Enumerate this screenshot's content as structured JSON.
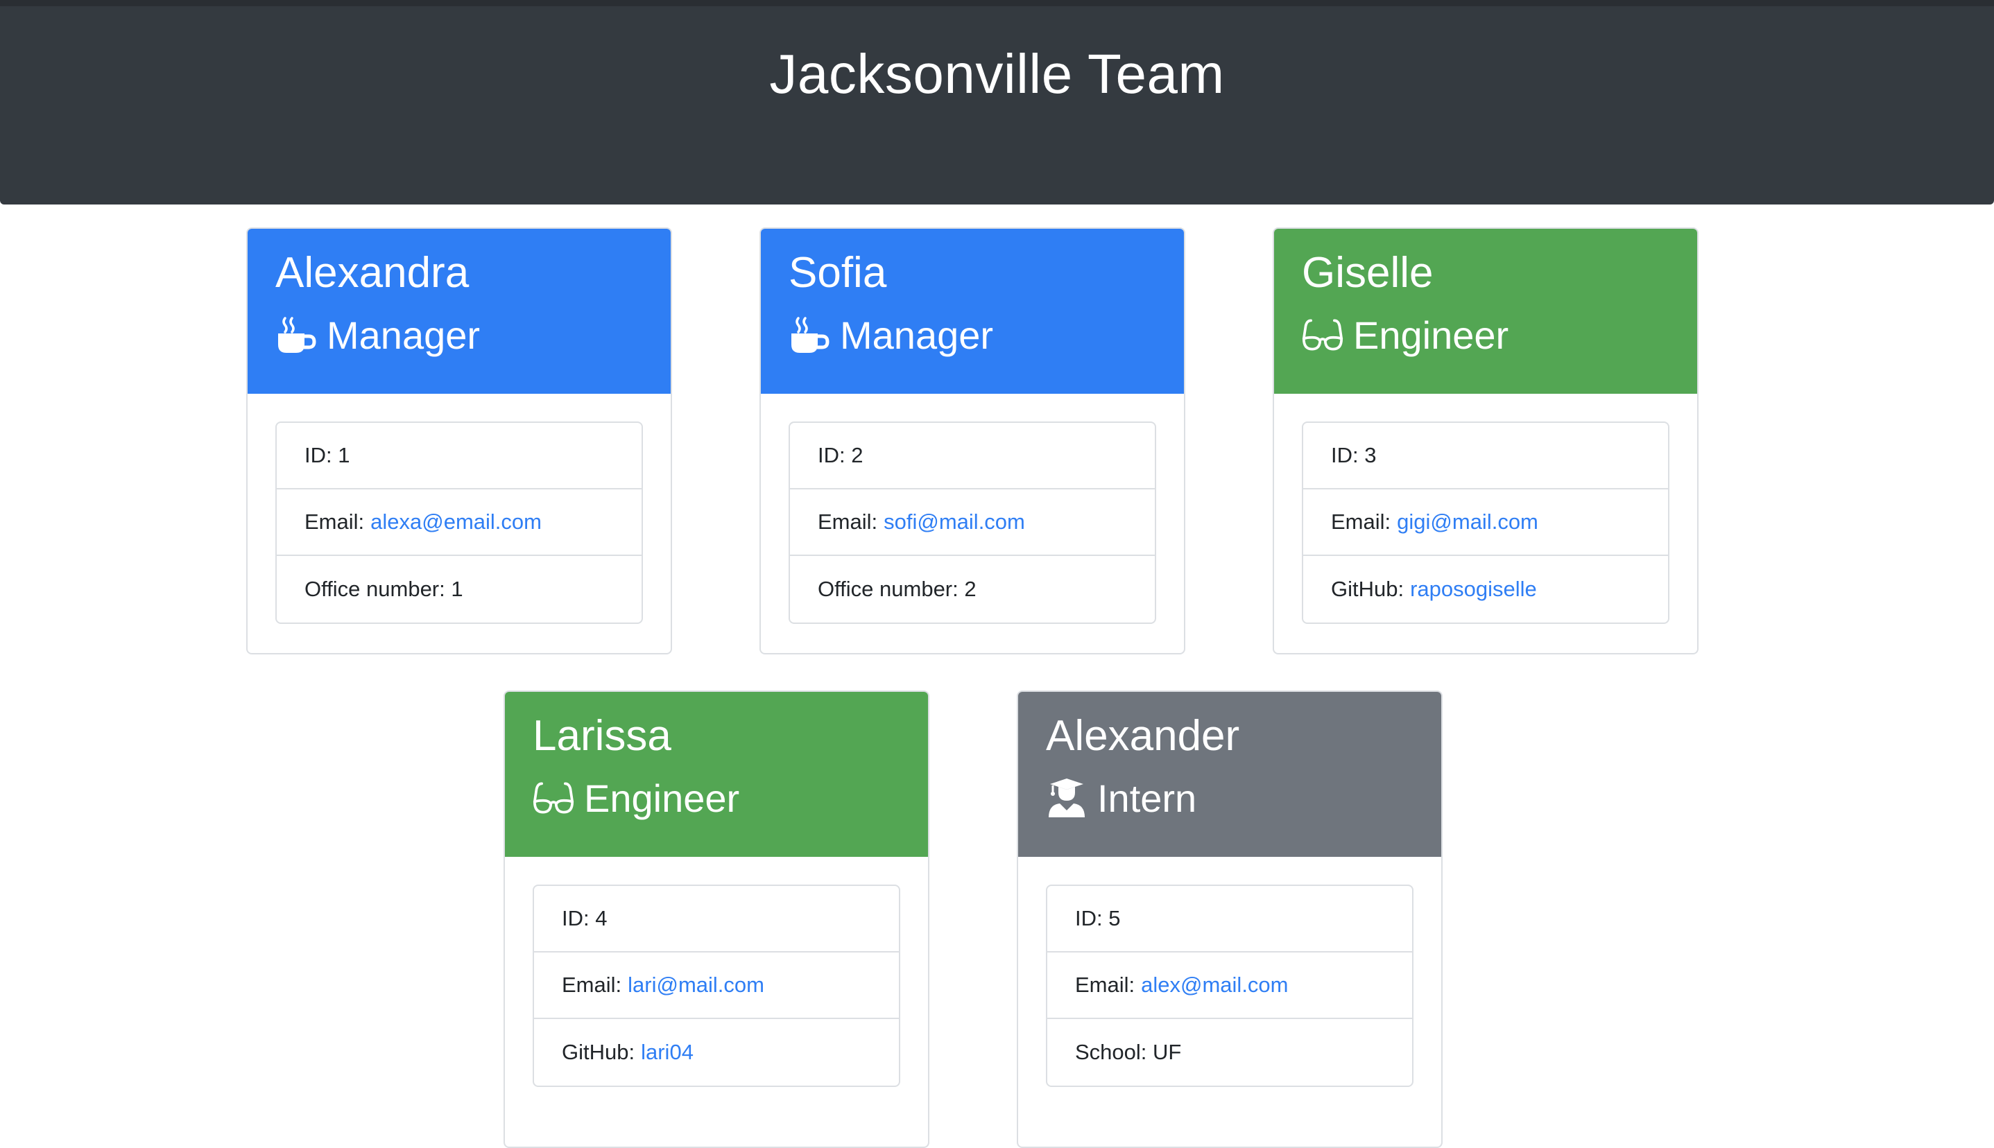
{
  "header": {
    "title": "Jacksonville Team"
  },
  "colors": {
    "manager": "#2f7ef4",
    "engineer": "#53a653",
    "intern": "#6f757d",
    "header_bg": "#343a40",
    "link": "#2f7ef4"
  },
  "cards": [
    {
      "name": "Alexandra",
      "role": "Manager",
      "icon": "mug-hot-icon",
      "id_label": "ID:",
      "id_value": "1",
      "email_label": "Email:",
      "email": "alexa@email.com",
      "extra_label": "Office number:",
      "extra_value": "1"
    },
    {
      "name": "Sofia",
      "role": "Manager",
      "icon": "mug-hot-icon",
      "id_label": "ID:",
      "id_value": "2",
      "email_label": "Email:",
      "email": "sofi@mail.com",
      "extra_label": "Office number:",
      "extra_value": "2"
    },
    {
      "name": "Giselle",
      "role": "Engineer",
      "icon": "glasses-icon",
      "id_label": "ID:",
      "id_value": "3",
      "email_label": "Email:",
      "email": "gigi@mail.com",
      "extra_label": "GitHub:",
      "extra_value": "raposogiselle"
    },
    {
      "name": "Larissa",
      "role": "Engineer",
      "icon": "glasses-icon",
      "id_label": "ID:",
      "id_value": "4",
      "email_label": "Email:",
      "email": "lari@mail.com",
      "extra_label": "GitHub:",
      "extra_value": "lari04"
    },
    {
      "name": "Alexander",
      "role": "Intern",
      "icon": "user-graduate-icon",
      "id_label": "ID:",
      "id_value": "5",
      "email_label": "Email:",
      "email": "alex@mail.com",
      "extra_label": "School:",
      "extra_value": "UF"
    }
  ]
}
